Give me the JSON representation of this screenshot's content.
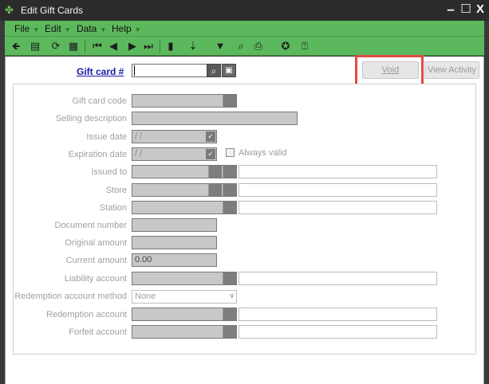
{
  "window": {
    "title": "Edit Gift Cards",
    "controls": {
      "minimize": "–",
      "maximize": "☐",
      "close": "X"
    }
  },
  "menu": [
    {
      "label": "File"
    },
    {
      "label": "Edit"
    },
    {
      "label": "Data"
    },
    {
      "label": "Help"
    }
  ],
  "toolbar_icons": [
    "back-arrow-icon",
    "save-icon",
    "refresh-icon",
    "grid-icon",
    "first-record-icon",
    "previous-record-icon",
    "next-record-icon",
    "last-record-icon",
    "chart-icon",
    "sort-icon",
    "filter-icon",
    "search-icon",
    "print-icon",
    "help-icon",
    "about-icon"
  ],
  "gift_card": {
    "label": "Gift card #",
    "value": ""
  },
  "buttons": {
    "void": "Void",
    "view_activity": "View Activity"
  },
  "form": {
    "gift_card_code": "Gift card code",
    "selling_description": "Selling description",
    "issue_date": {
      "label": "Issue date",
      "value": "/ /"
    },
    "expiration_date": {
      "label": "Expiration date",
      "value": "/ /"
    },
    "always_valid": "Always valid",
    "issued_to": "Issued to",
    "store": "Store",
    "station": "Station",
    "document_number": "Document number",
    "original_amount": "Original amount",
    "current_amount": {
      "label": "Current amount",
      "value": "0.00"
    },
    "liability_account": "Liability account",
    "redemption_account_method": {
      "label": "Redemption account method",
      "value": "None"
    },
    "redemption_account": "Redemption account",
    "forfeit_account": "Forfeit account"
  },
  "colors": {
    "accent_green": "#5cb85c",
    "highlight_red": "#e24a4a",
    "label_blue": "#1a1aa8"
  }
}
